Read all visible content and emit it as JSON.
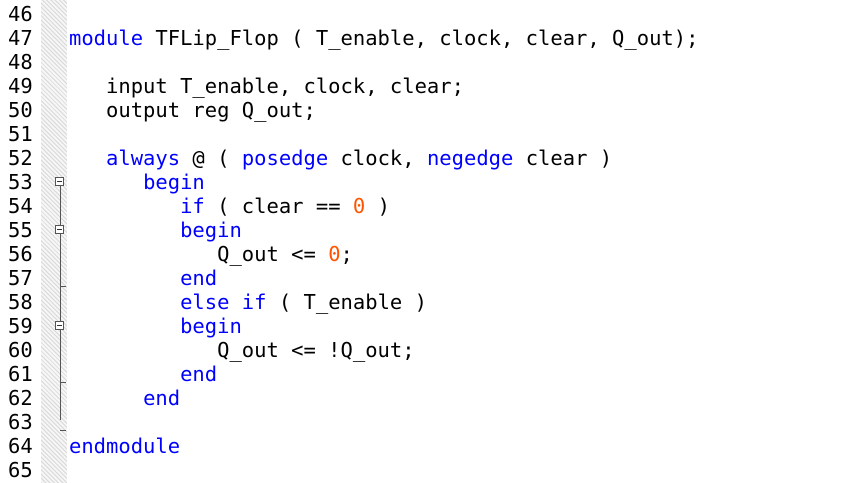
{
  "editor": {
    "lines": [
      {
        "num": "46",
        "tokens": []
      },
      {
        "num": "47",
        "tokens": [
          {
            "t": "module",
            "c": "kw"
          },
          {
            "t": " TFLip_Flop ( T_enable, clock, clear, Q_out);",
            "c": ""
          }
        ]
      },
      {
        "num": "48",
        "tokens": []
      },
      {
        "num": "49",
        "tokens": [
          {
            "t": "   input T_enable, clock, clear;",
            "c": ""
          }
        ]
      },
      {
        "num": "50",
        "tokens": [
          {
            "t": "   output reg Q_out;",
            "c": ""
          }
        ]
      },
      {
        "num": "51",
        "tokens": []
      },
      {
        "num": "52",
        "tokens": [
          {
            "t": "   ",
            "c": ""
          },
          {
            "t": "always",
            "c": "kw"
          },
          {
            "t": " @ ( ",
            "c": ""
          },
          {
            "t": "posedge",
            "c": "kw"
          },
          {
            "t": " clock, ",
            "c": ""
          },
          {
            "t": "negedge",
            "c": "kw"
          },
          {
            "t": " clear )",
            "c": ""
          }
        ]
      },
      {
        "num": "53",
        "tokens": [
          {
            "t": "      ",
            "c": ""
          },
          {
            "t": "begin",
            "c": "kw"
          }
        ]
      },
      {
        "num": "54",
        "tokens": [
          {
            "t": "         ",
            "c": ""
          },
          {
            "t": "if",
            "c": "kw"
          },
          {
            "t": " ( clear == ",
            "c": ""
          },
          {
            "t": "0",
            "c": "num"
          },
          {
            "t": " )",
            "c": ""
          }
        ]
      },
      {
        "num": "55",
        "tokens": [
          {
            "t": "         ",
            "c": ""
          },
          {
            "t": "begin",
            "c": "kw"
          }
        ]
      },
      {
        "num": "56",
        "tokens": [
          {
            "t": "            Q_out <= ",
            "c": ""
          },
          {
            "t": "0",
            "c": "num"
          },
          {
            "t": ";",
            "c": ""
          }
        ]
      },
      {
        "num": "57",
        "tokens": [
          {
            "t": "         ",
            "c": ""
          },
          {
            "t": "end",
            "c": "kw"
          }
        ]
      },
      {
        "num": "58",
        "tokens": [
          {
            "t": "         ",
            "c": ""
          },
          {
            "t": "else if",
            "c": "kw"
          },
          {
            "t": " ( T_enable )",
            "c": ""
          }
        ]
      },
      {
        "num": "59",
        "tokens": [
          {
            "t": "         ",
            "c": ""
          },
          {
            "t": "begin",
            "c": "kw"
          }
        ]
      },
      {
        "num": "60",
        "tokens": [
          {
            "t": "            Q_out <= !Q_out;",
            "c": ""
          }
        ]
      },
      {
        "num": "61",
        "tokens": [
          {
            "t": "         ",
            "c": ""
          },
          {
            "t": "end",
            "c": "kw"
          }
        ]
      },
      {
        "num": "62",
        "tokens": [
          {
            "t": "      ",
            "c": ""
          },
          {
            "t": "end",
            "c": "kw"
          }
        ]
      },
      {
        "num": "63",
        "tokens": []
      },
      {
        "num": "64",
        "tokens": [
          {
            "t": "endmodule",
            "c": "kw"
          }
        ]
      },
      {
        "num": "65",
        "tokens": []
      }
    ],
    "colors": {
      "keyword": "#0000ff",
      "number": "#ff5500",
      "text": "#000000"
    },
    "fold_markers": [
      {
        "line": "53",
        "icon": "collapse-box-icon"
      },
      {
        "line": "55",
        "icon": "collapse-box-icon"
      },
      {
        "line": "57",
        "icon": "fold-end-tick"
      },
      {
        "line": "59",
        "icon": "collapse-box-icon"
      },
      {
        "line": "61",
        "icon": "fold-end-tick"
      },
      {
        "line": "63",
        "icon": "fold-end-tick"
      }
    ]
  }
}
